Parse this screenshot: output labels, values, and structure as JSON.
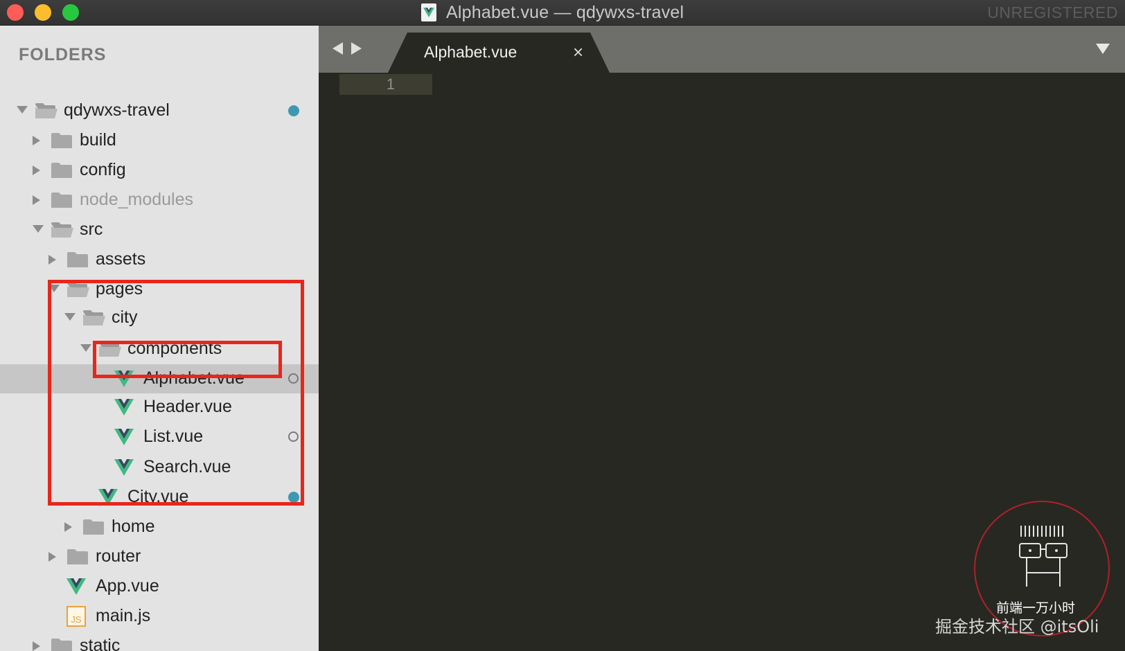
{
  "window": {
    "title": "Alphabet.vue — qdywxs-travel",
    "license_status": "UNREGISTERED"
  },
  "sidebar": {
    "header": "FOLDERS",
    "items": [
      {
        "label": "qdywxs-travel",
        "type": "folder",
        "expanded": true,
        "status": "modified"
      },
      {
        "label": "build",
        "type": "folder",
        "expanded": false
      },
      {
        "label": "config",
        "type": "folder",
        "expanded": false
      },
      {
        "label": "node_modules",
        "type": "folder",
        "expanded": false,
        "dimmed": true
      },
      {
        "label": "src",
        "type": "folder",
        "expanded": true
      },
      {
        "label": "assets",
        "type": "folder",
        "expanded": false
      },
      {
        "label": "pages",
        "type": "folder",
        "expanded": true
      },
      {
        "label": "city",
        "type": "folder",
        "expanded": true
      },
      {
        "label": "components",
        "type": "folder",
        "expanded": true
      },
      {
        "label": "Alphabet.vue",
        "type": "vue",
        "selected": true,
        "status": "untracked"
      },
      {
        "label": "Header.vue",
        "type": "vue"
      },
      {
        "label": "List.vue",
        "type": "vue",
        "status": "untracked"
      },
      {
        "label": "Search.vue",
        "type": "vue"
      },
      {
        "label": "City.vue",
        "type": "vue",
        "status": "modified"
      },
      {
        "label": "home",
        "type": "folder",
        "expanded": false
      },
      {
        "label": "router",
        "type": "folder",
        "expanded": false
      },
      {
        "label": "App.vue",
        "type": "vue"
      },
      {
        "label": "main.js",
        "type": "js"
      },
      {
        "label": "static",
        "type": "folder",
        "expanded": false
      }
    ]
  },
  "editor": {
    "tab_label": "Alphabet.vue",
    "tab_close": "×",
    "line_numbers": [
      "1"
    ]
  },
  "watermark": {
    "stamp_text": "前端一万小时",
    "site_text": "掘金技术社区 @itsOli"
  },
  "colors": {
    "sidebar_bg": "#e3e3e3",
    "editor_bg": "#272822",
    "highlight": "#e8261b",
    "vue_icon": "#41b883",
    "status_dot": "#3c9ab0"
  }
}
